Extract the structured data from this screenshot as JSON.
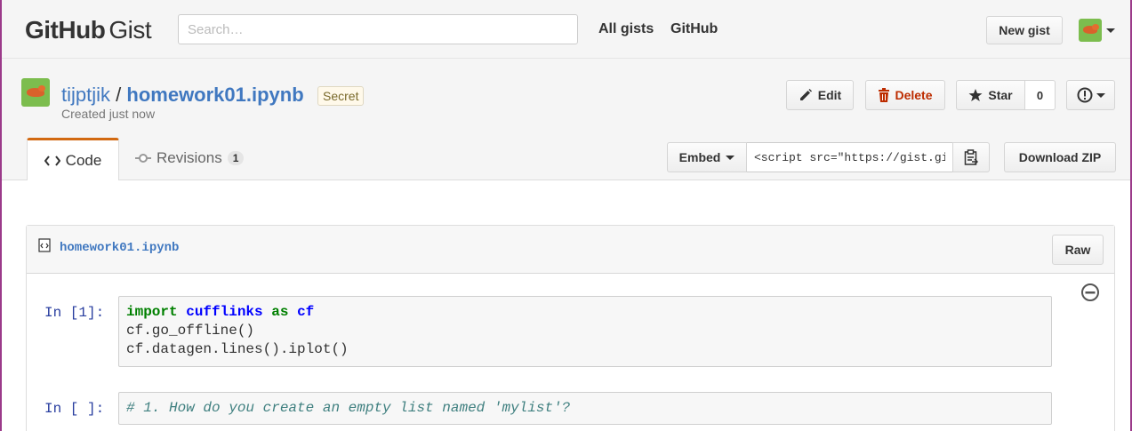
{
  "header": {
    "logo_github": "GitHub",
    "logo_gist": "Gist",
    "search_placeholder": "Search…",
    "nav": {
      "all_gists": "All gists",
      "github": "GitHub"
    },
    "new_gist_label": "New gist"
  },
  "gist": {
    "owner": "tijptjik",
    "separator": "/",
    "filename": "homework01.ipynb",
    "visibility": "Secret",
    "created": "Created just now",
    "actions": {
      "edit": "Edit",
      "delete": "Delete",
      "star": "Star",
      "star_count": "0"
    }
  },
  "tabs": {
    "code": "Code",
    "revisions": "Revisions",
    "revisions_count": "1"
  },
  "embed": {
    "label": "Embed",
    "value": "<script src=\"https://gist.github.com/",
    "download": "Download ZIP"
  },
  "file": {
    "name": "homework01.ipynb",
    "raw_label": "Raw",
    "cells": [
      {
        "prompt": "In [1]:",
        "lines": [
          {
            "t1": "import",
            "t2": "cufflinks",
            "t3": "as",
            "t4": "cf"
          },
          {
            "text": "cf.go_offline()"
          },
          {
            "text": "cf.datagen.lines().iplot()"
          }
        ]
      },
      {
        "prompt": "In [ ]:",
        "comment": "# 1. How do you create an empty list named 'mylist'?"
      }
    ]
  },
  "colors": {
    "accent_tab": "#d26911",
    "link": "#4078c0",
    "delete": "#bd2c00",
    "frame": "#9b3a8a"
  }
}
